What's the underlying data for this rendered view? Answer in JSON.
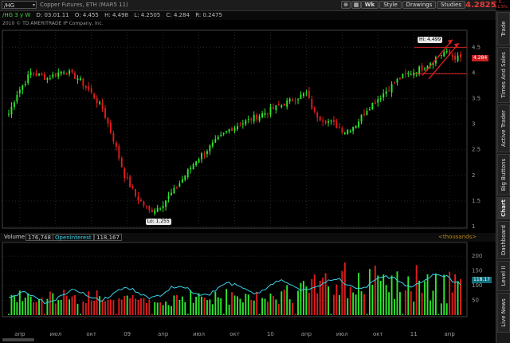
{
  "toolbar": {
    "symbol": "/HG",
    "title": "Copper Futures, ETH (MAR5 11)",
    "period_button": "Wk",
    "style_label": "Style",
    "drawings_label": "Drawings",
    "studies_label": "Studies",
    "last_price": "4.2825",
    "change_top": "+.0...",
    "change_bottom": "+1.5%"
  },
  "header": {
    "period": "/HG 3 y W",
    "date": "D: 03.01.11",
    "open": "O: 4.455",
    "high": "H: 4.498",
    "low": "L: 4.2505",
    "close": "C: 4.284",
    "range": "R: 0.2475",
    "copyright": "2010 © TD AMERITRADE IP Company, Inc."
  },
  "price_axis": [
    "4.5",
    "4",
    "3.5",
    "3",
    "2.5",
    "2",
    "1.5",
    "1"
  ],
  "annotations": {
    "high_label": "Hi: 4.499",
    "low_label": "Lo: 1.255",
    "last_label": "4.284"
  },
  "volume_panel": {
    "volume_label": "Volume",
    "volume_value": "176,748",
    "oi_label": "OpenInterest",
    "oi_value": "118,167",
    "unit": "<thousands>",
    "axis": [
      "200",
      "150",
      "100",
      "50"
    ],
    "oi_marker": "118.17"
  },
  "time_axis": [
    "апр",
    "июл",
    "окт",
    "09",
    "апр",
    "июл",
    "окт",
    "10",
    "апр",
    "июл",
    "окт",
    "11",
    "апр"
  ],
  "side_tabs": [
    "Trade",
    "Times And Sales",
    "Active Trader",
    "Big Buttons",
    "Chart",
    "Dashboard",
    "Level II",
    "Live News"
  ],
  "colors": {
    "up": "#2ee82e",
    "down": "#e01d1d",
    "oi_line": "#38d0e8",
    "accent": "#e23a3a"
  },
  "chart_data": {
    "type": "candlestick",
    "title": "Copper Futures, ETH (MAR5 11)",
    "xlabel": "",
    "ylabel": "",
    "ylim": [
      1,
      4.8
    ],
    "weeks": 165,
    "close_anchors": [
      [
        0,
        3.2
      ],
      [
        3,
        3.6
      ],
      [
        8,
        4.0
      ],
      [
        14,
        3.9
      ],
      [
        20,
        4.05
      ],
      [
        25,
        3.9
      ],
      [
        30,
        3.6
      ],
      [
        34,
        3.3
      ],
      [
        38,
        2.7
      ],
      [
        42,
        2.0
      ],
      [
        46,
        1.6
      ],
      [
        51,
        1.3
      ],
      [
        55,
        1.4
      ],
      [
        60,
        1.7
      ],
      [
        64,
        2.0
      ],
      [
        68,
        2.3
      ],
      [
        72,
        2.5
      ],
      [
        76,
        2.7
      ],
      [
        80,
        2.9
      ],
      [
        84,
        3.0
      ],
      [
        88,
        3.1
      ],
      [
        92,
        3.2
      ],
      [
        96,
        3.3
      ],
      [
        100,
        3.4
      ],
      [
        104,
        3.5
      ],
      [
        108,
        3.6
      ],
      [
        111,
        3.2
      ],
      [
        114,
        3.1
      ],
      [
        118,
        3.0
      ],
      [
        122,
        2.85
      ],
      [
        126,
        3.0
      ],
      [
        130,
        3.3
      ],
      [
        134,
        3.5
      ],
      [
        138,
        3.7
      ],
      [
        142,
        3.9
      ],
      [
        146,
        4.0
      ],
      [
        150,
        4.1
      ],
      [
        154,
        4.25
      ],
      [
        158,
        4.4
      ],
      [
        162,
        4.3
      ],
      [
        164,
        4.284
      ]
    ],
    "high": 4.499,
    "low": 1.255,
    "last": 4.284,
    "volume_ylim": [
      0,
      230
    ],
    "oi_last": 118.17
  }
}
